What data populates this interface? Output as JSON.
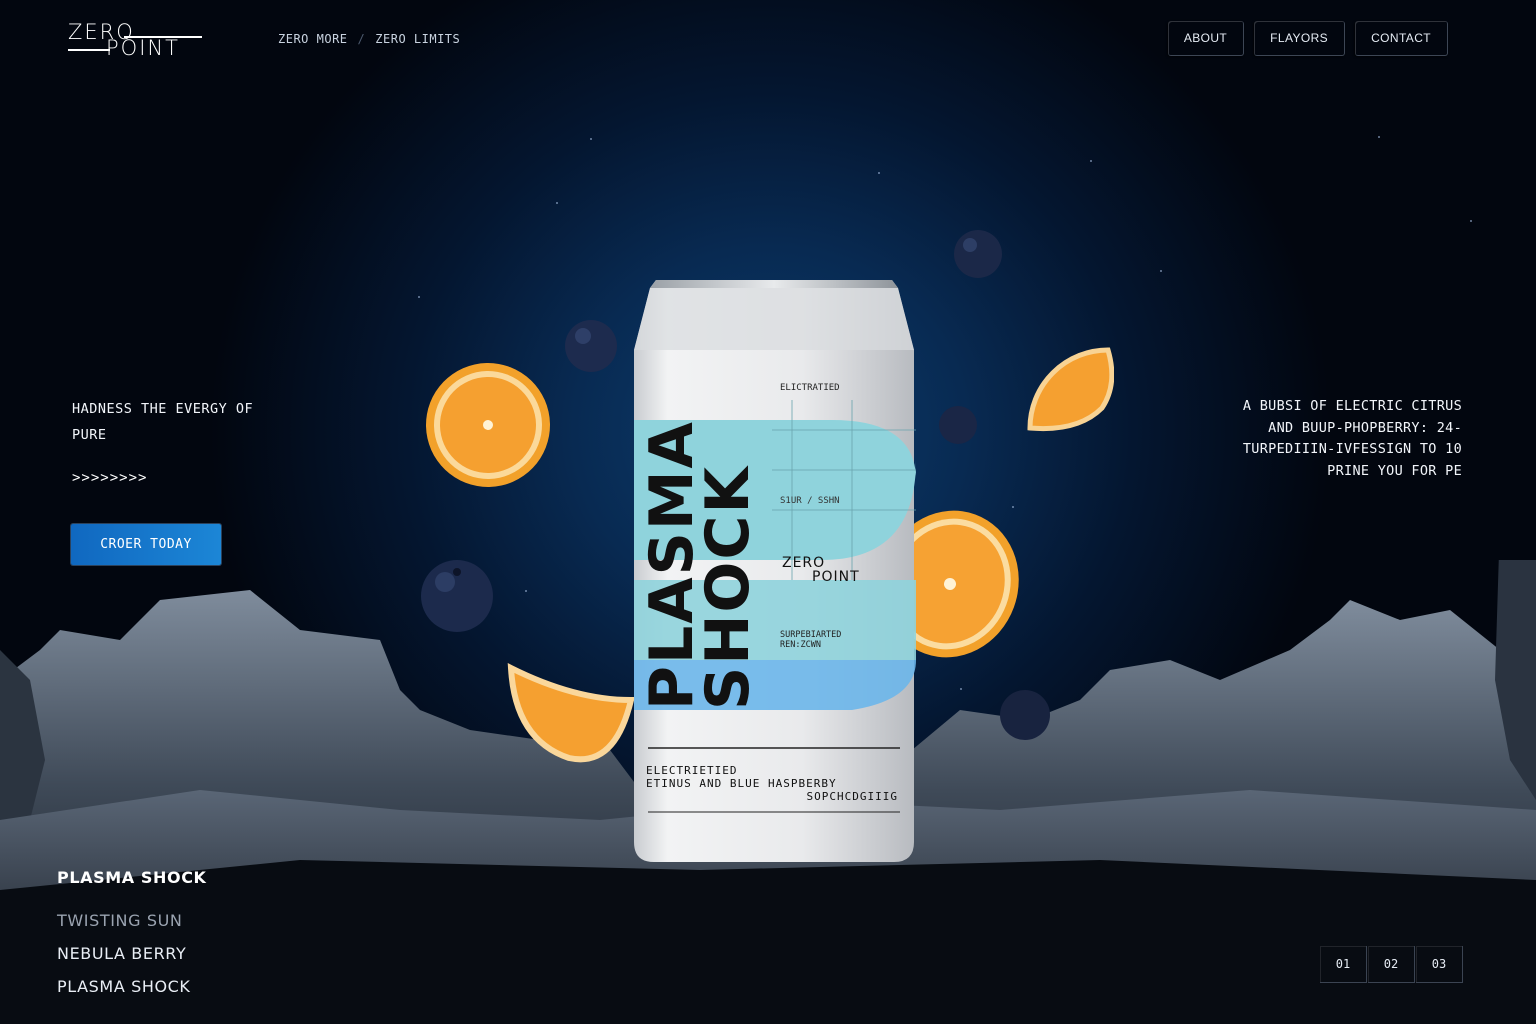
{
  "brand": {
    "line1": "ZERO",
    "line2": "POINT"
  },
  "tagline": {
    "part1": "ZERO MORE",
    "separator": "/",
    "part2": "ZERO LIMITS"
  },
  "nav": {
    "items": [
      "ABOUT",
      "FLAYORS",
      "CONTACT"
    ]
  },
  "hero": {
    "intro_line1": "HADNESS THE EVERGY OF",
    "intro_line2": "PURE",
    "arrows": ">>>>>>>>",
    "cta_label": "CROER TODAY",
    "right_copy": [
      "A BUBSI OF ELECTRIC CITRUS",
      "AND BUUP-PHOPBERRY: 24-",
      "TURPEDIIIN-IVFESSIGN TO 10",
      "PRINE YOU FOR PE"
    ]
  },
  "can": {
    "name_line1": "PLASMA",
    "name_line2": "SHOCK",
    "label_top": "ELICTRATIED",
    "label_mid": "S1UR / SSHN",
    "logo_line1": "ZERO",
    "logo_line2": "POINT",
    "label_small1": "SURPEBIARTED",
    "label_small2": "REN:ZCWN",
    "bottom_line1": "ELECTRIETIED",
    "bottom_line2": "ETINUS AND BLUE HASPBERBY",
    "bottom_line3": "SOPCHCDGIIIG",
    "stripe_color": "#8fd3dc",
    "stripe_color2": "#6bb6ea"
  },
  "flavors": {
    "current": "PLASMA SHOCK",
    "items": [
      "TWISTING SUN",
      "NEBULA BERRY",
      "PLASMA SHOCK"
    ]
  },
  "pager": {
    "pages": [
      "01",
      "02",
      "03"
    ]
  },
  "colors": {
    "cta": "#1a7fd0",
    "background": "#041630"
  }
}
